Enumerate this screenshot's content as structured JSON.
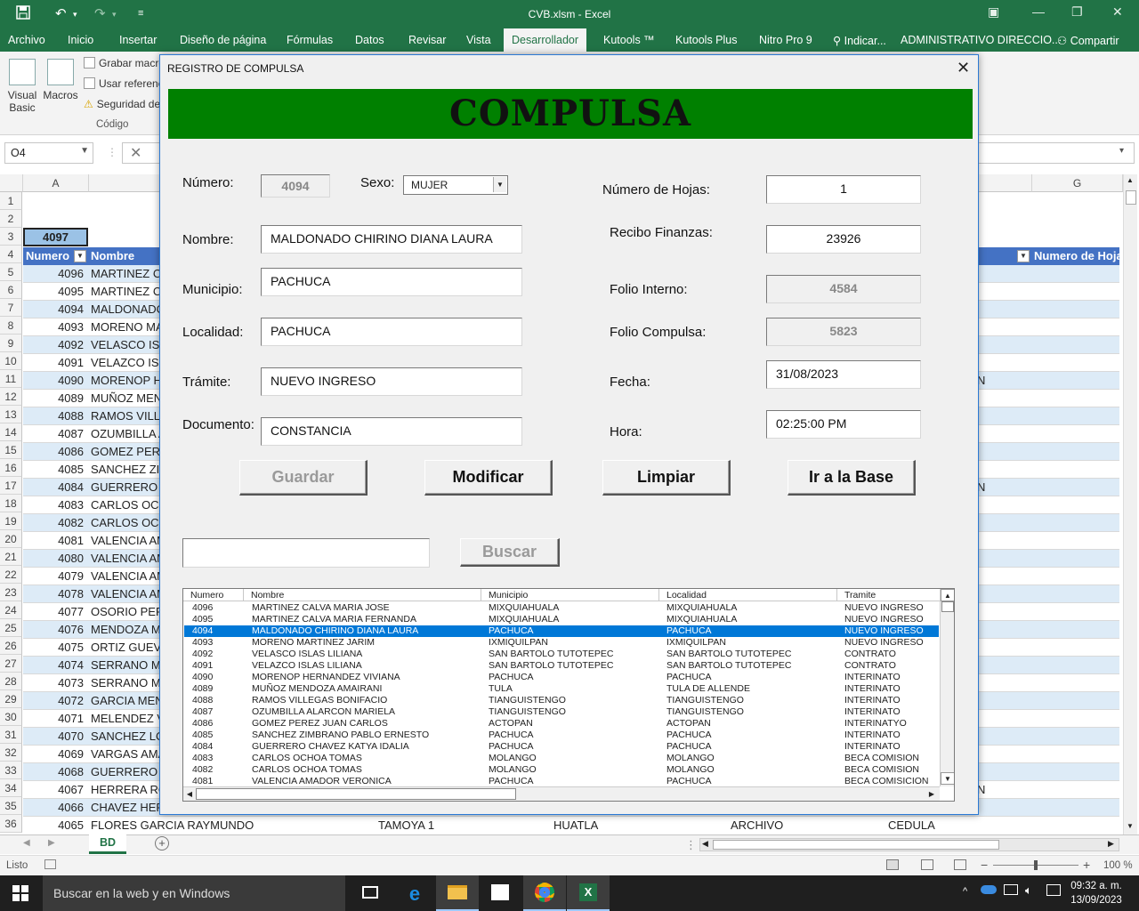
{
  "window": {
    "title": "CVB.xlsm - Excel",
    "qat": [
      "save-icon",
      "undo-icon",
      "redo-icon",
      "customize-icon"
    ]
  },
  "ribbon_tabs": [
    "Archivo",
    "Inicio",
    "Insertar",
    "Diseño de página",
    "Fórmulas",
    "Datos",
    "Revisar",
    "Vista",
    "Desarrollador",
    "Kutools ™",
    "Kutools Plus",
    "Nitro Pro 9",
    "Indicar...",
    "ADMINISTRATIVO DIRECCIO...",
    "Compartir"
  ],
  "ribbon": {
    "visual_basic": "Visual Basic",
    "macros": "Macros",
    "grabar_macro": "Grabar macro",
    "usar_referencias": "Usar referencias",
    "seguridad": "Seguridad de",
    "group_label": "Código"
  },
  "formula_bar": {
    "name_box": "O4",
    "value": ""
  },
  "grid": {
    "col_a": "A",
    "col_g": "G",
    "a3_value": "4097",
    "header_numero": "Numero",
    "header_nombre": "Nombre",
    "header_numero_hojas": "Numero de Hoja",
    "row_numbers": [
      "1",
      "2",
      "3",
      "4",
      "5",
      "6",
      "7",
      "8",
      "9",
      "10",
      "11",
      "12",
      "13",
      "14",
      "15",
      "16",
      "17",
      "18",
      "19",
      "20",
      "21",
      "22",
      "23",
      "24",
      "25",
      "26",
      "27",
      "28",
      "29",
      "30",
      "31",
      "32",
      "33",
      "34",
      "35",
      "36"
    ],
    "rows": [
      {
        "num": "4096",
        "nombre": "MARTINEZ CA",
        "tail": ""
      },
      {
        "num": "4095",
        "nombre": "MARTINEZ CA",
        "tail": ""
      },
      {
        "num": "4094",
        "nombre": "MALDONADO",
        "tail": ""
      },
      {
        "num": "4093",
        "nombre": "MORENO MA",
        "tail": ""
      },
      {
        "num": "4092",
        "nombre": "VELASCO ISL",
        "tail": ""
      },
      {
        "num": "4091",
        "nombre": "VELAZCO ISL",
        "tail": ""
      },
      {
        "num": "4090",
        "nombre": "MORENOP H",
        "tail": "N"
      },
      {
        "num": "4089",
        "nombre": "MUÑOZ MEN",
        "tail": ""
      },
      {
        "num": "4088",
        "nombre": "RAMOS VILLE",
        "tail": ""
      },
      {
        "num": "4087",
        "nombre": "OZUMBILLA A",
        "tail": ""
      },
      {
        "num": "4086",
        "nombre": "GOMEZ PERE",
        "tail": ""
      },
      {
        "num": "4085",
        "nombre": "SANCHEZ ZIM",
        "tail": ""
      },
      {
        "num": "4084",
        "nombre": "GUERRERO C",
        "tail": "N"
      },
      {
        "num": "4083",
        "nombre": "CARLOS OCH",
        "tail": ""
      },
      {
        "num": "4082",
        "nombre": "CARLOS OCH",
        "tail": ""
      },
      {
        "num": "4081",
        "nombre": "VALENCIA AM",
        "tail": ""
      },
      {
        "num": "4080",
        "nombre": "VALENCIA AM",
        "tail": ""
      },
      {
        "num": "4079",
        "nombre": "VALENCIA AM",
        "tail": ""
      },
      {
        "num": "4078",
        "nombre": "VALENCIA AM",
        "tail": ""
      },
      {
        "num": "4077",
        "nombre": "OSORIO PERI",
        "tail": ""
      },
      {
        "num": "4076",
        "nombre": "MENDOZA M",
        "tail": ""
      },
      {
        "num": "4075",
        "nombre": "ORTIZ GUEVA",
        "tail": ""
      },
      {
        "num": "4074",
        "nombre": "SERRANO MA",
        "tail": ""
      },
      {
        "num": "4073",
        "nombre": "SERRANO MA",
        "tail": ""
      },
      {
        "num": "4072",
        "nombre": "GARCIA MEN",
        "tail": ""
      },
      {
        "num": "4071",
        "nombre": "MELENDEZ V",
        "tail": ""
      },
      {
        "num": "4070",
        "nombre": "SANCHEZ LO",
        "tail": ""
      },
      {
        "num": "4069",
        "nombre": "VARGAS AMA",
        "tail": ""
      },
      {
        "num": "4068",
        "nombre": "GUERRERO R",
        "tail": ""
      },
      {
        "num": "4067",
        "nombre": "HERRERA RO",
        "tail": "N"
      },
      {
        "num": "4066",
        "nombre": "CHAVEZ HER",
        "tail": ""
      }
    ],
    "row36": {
      "num": "4065",
      "nombre": "FLORES GARCIA RAYMUNDO",
      "municipio": "TAMOYA 1",
      "localidad": "HUATLA",
      "tramite": "ARCHIVO",
      "documento": "CEDULA"
    }
  },
  "sheet_tab": "BD",
  "status": {
    "left": "Listo",
    "zoom": "100 %"
  },
  "taskbar": {
    "search": "Buscar en la web y en Windows",
    "time": "09:32 a. m.",
    "date": "13/09/2023"
  },
  "dialog": {
    "title": "REGISTRO DE COMPULSA",
    "banner": "COMPULSA",
    "labels": {
      "numero": "Número:",
      "sexo": "Sexo:",
      "nombre": "Nombre:",
      "municipio": "Municipio:",
      "localidad": "Localidad:",
      "tramite": "Trámite:",
      "documento": "Documento:",
      "numero_hojas": "Número de Hojas:",
      "recibo": "Recibo Finanzas:",
      "folio_interno": "Folio Interno:",
      "folio_compulsa": "Folio Compulsa:",
      "fecha": "Fecha:",
      "hora": "Hora:"
    },
    "values": {
      "numero": "4094",
      "sexo": "MUJER",
      "nombre": "MALDONADO CHIRINO DIANA LAURA",
      "municipio": "PACHUCA",
      "localidad": "PACHUCA",
      "tramite": "NUEVO INGRESO",
      "documento": "CONSTANCIA",
      "numero_hojas": "1",
      "recibo": "23926",
      "folio_interno": "4584",
      "folio_compulsa": "5823",
      "fecha": "31/08/2023",
      "hora": "02:25:00 PM"
    },
    "buttons": {
      "guardar": "Guardar",
      "modificar": "Modificar",
      "limpiar": "Limpiar",
      "ir_base": "Ir a la Base",
      "buscar": "Buscar"
    },
    "search_value": "",
    "list": {
      "headers": [
        "Numero",
        "Nombre",
        "Municipio",
        "Localidad",
        "Tramite"
      ],
      "selected_index": 2,
      "rows": [
        [
          "4096",
          "MARTINEZ CALVA MARIA JOSE",
          "MIXQUIAHUALA",
          "MIXQUIAHUALA",
          "NUEVO INGRESO"
        ],
        [
          "4095",
          "MARTINEZ CALVA MARIA FERNANDA",
          "MIXQUIAHUALA",
          "MIXQUIAHUALA",
          "NUEVO INGRESO"
        ],
        [
          "4094",
          "MALDONADO CHIRINO DIANA LAURA",
          "PACHUCA",
          "PACHUCA",
          "NUEVO INGRESO"
        ],
        [
          "4093",
          "MORENO MARTINEZ JARIM",
          "IXMIQUILPAN",
          "IXMIQUILPAN",
          "NUEVO INGRESO"
        ],
        [
          "4092",
          "VELASCO ISLAS LILIANA",
          "SAN BARTOLO TUTOTEPEC",
          "SAN BARTOLO TUTOTEPEC",
          "CONTRATO"
        ],
        [
          "4091",
          "VELAZCO ISLAS LILIANA",
          "SAN BARTOLO TUTOTEPEC",
          "SAN BARTOLO TUTOTEPEC",
          "CONTRATO"
        ],
        [
          "4090",
          "MORENOP HERNANDEZ VIVIANA",
          "PACHUCA",
          "PACHUCA",
          "INTERINATO"
        ],
        [
          "4089",
          "MUÑOZ MENDOZA AMAIRANI",
          "TULA",
          "TULA DE ALLENDE",
          "INTERINATO"
        ],
        [
          "4088",
          "RAMOS VILLEGAS BONIFACIO",
          "TIANGUISTENGO",
          "TIANGUISTENGO",
          "INTERINATO"
        ],
        [
          "4087",
          "OZUMBILLA ALARCON MARIELA",
          "TIANGUISTENGO",
          "TIANGUISTENGO",
          "INTERINATO"
        ],
        [
          "4086",
          "GOMEZ PEREZ JUAN CARLOS",
          "ACTOPAN",
          "ACTOPAN",
          "INTERINATYO"
        ],
        [
          "4085",
          "SANCHEZ ZIMBRANO PABLO ERNESTO",
          "PACHUCA",
          "PACHUCA",
          "INTERINATO"
        ],
        [
          "4084",
          "GUERRERO CHAVEZ  KATYA IDALIA",
          "PACHUCA",
          "PACHUCA",
          "INTERINATO"
        ],
        [
          "4083",
          "CARLOS OCHOA TOMAS",
          "MOLANGO",
          "MOLANGO",
          "BECA COMISION"
        ],
        [
          "4082",
          "CARLOS OCHOA TOMAS",
          "MOLANGO",
          "MOLANGO",
          "BECA COMISION"
        ],
        [
          "4081",
          "VALENCIA AMADOR VERONICA",
          "PACHUCA",
          "PACHUCA",
          "BECA COMISICION"
        ]
      ]
    }
  },
  "colors": {
    "excel_green": "#217346",
    "banner_green": "#008000",
    "table_header": "#4472c4",
    "row_band": "#ddebf7",
    "selection": "#0078d7"
  }
}
